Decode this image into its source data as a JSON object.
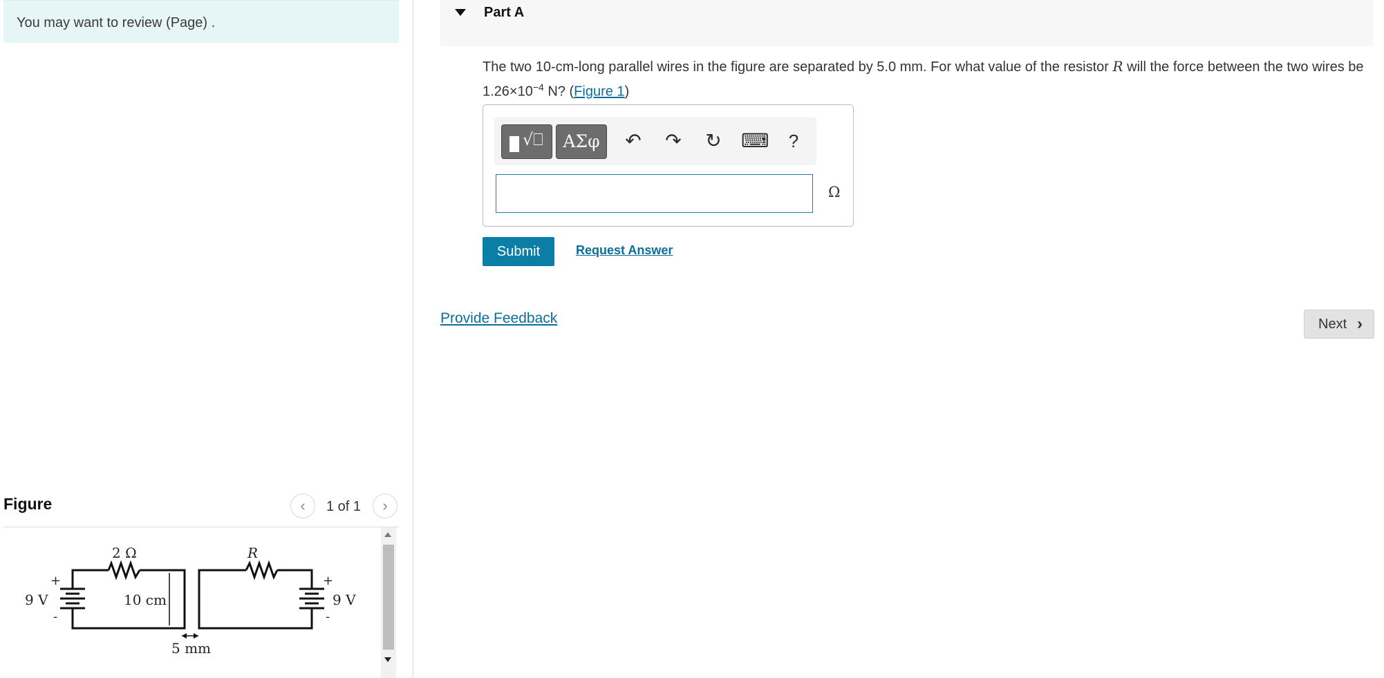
{
  "notice": {
    "text": "You may want to review (Page) ."
  },
  "figure_panel": {
    "title": "Figure",
    "pager": {
      "prev": "‹",
      "count": "1 of 1",
      "next": "›"
    },
    "diagram": {
      "left_resistor": "2 Ω",
      "right_resistor": "R",
      "left_battery": "9 V",
      "right_battery": "9 V",
      "wire_length": "10 cm",
      "separation": "5 mm",
      "plus": "+",
      "minus": "-"
    }
  },
  "part": {
    "title": "Part A"
  },
  "question": {
    "text_1": "The two 10-cm-long parallel wires in the figure are separated by 5.0 mm. For what value of the resistor ",
    "var": "R",
    "text_2": " will the force between the two wires be 1.26×10",
    "exponent": "−4",
    "text_3": " N? (",
    "figure_link": "Figure 1",
    "text_4": ")"
  },
  "toolbar": {
    "templates_icon": "templates-icon",
    "symbols_label": "ΑΣφ",
    "undo_icon": "↶",
    "redo_icon": "↷",
    "reset_icon": "↻",
    "keyboard_icon": "⌨",
    "help_label": "?"
  },
  "answer": {
    "value": "",
    "unit": "Ω"
  },
  "actions": {
    "submit": "Submit",
    "request_answer": "Request Answer",
    "provide_feedback": "Provide Feedback",
    "next": "Next",
    "next_icon": "›"
  },
  "colors": {
    "accent": "#0b7ea5",
    "link": "#0b6e99",
    "notice_bg": "#e6f5f5"
  }
}
